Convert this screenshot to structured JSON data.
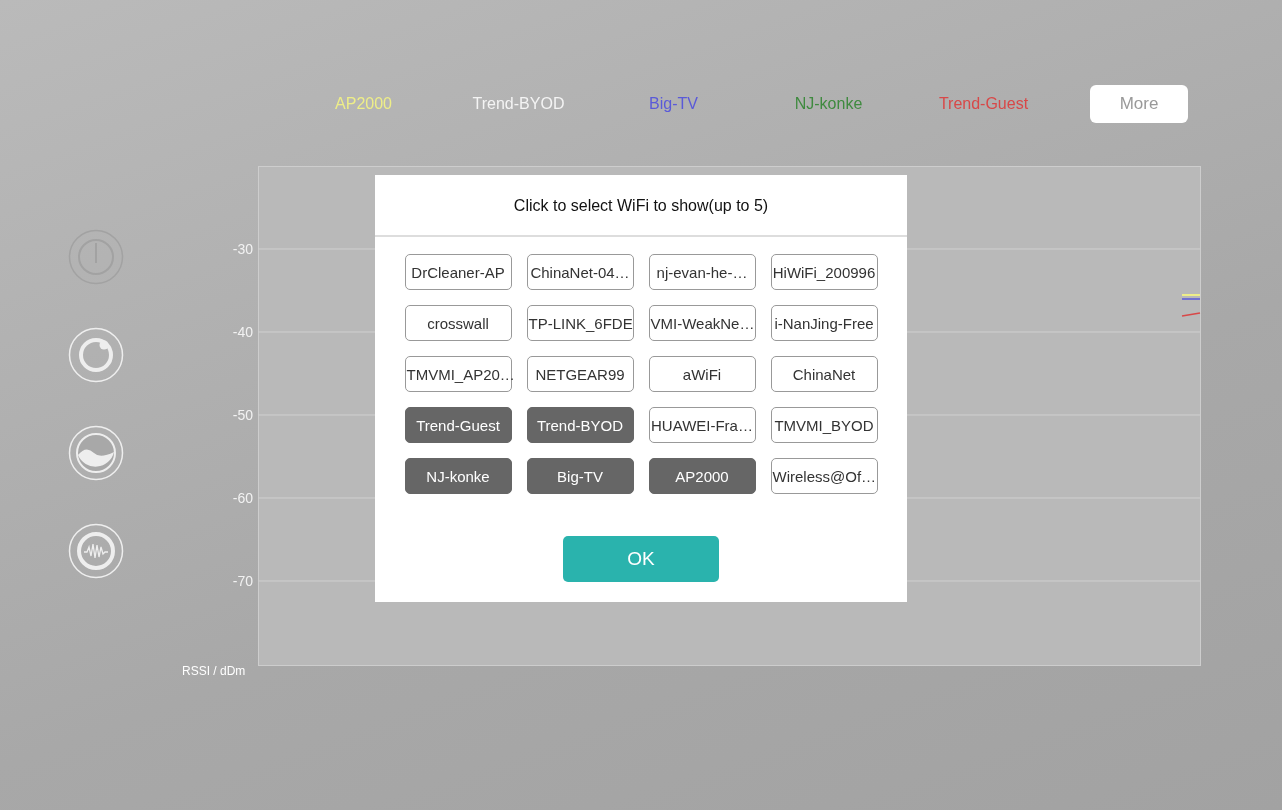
{
  "legend": [
    {
      "label": "AP2000",
      "color": "#eeee88"
    },
    {
      "label": "Trend-BYOD",
      "color": "#f4f4f4"
    },
    {
      "label": "Big-TV",
      "color": "#5a5ad8"
    },
    {
      "label": "NJ-konke",
      "color": "#3f8a3f"
    },
    {
      "label": "Trend-Guest",
      "color": "#d84848"
    }
  ],
  "more_button": "More",
  "side_buttons": [
    {
      "kind": "power",
      "disabled": true
    },
    {
      "kind": "ring",
      "disabled": false
    },
    {
      "kind": "wave",
      "disabled": false
    },
    {
      "kind": "pulse",
      "disabled": false
    }
  ],
  "chart": {
    "y_ticks": [
      "-30",
      "-40",
      "-50",
      "-60",
      "-70"
    ],
    "ylabel": "RSSI / dDm"
  },
  "dialog": {
    "title": "Click to select WiFi to show(up to 5)",
    "networks": [
      {
        "label": "DrCleaner-AP",
        "selected": false
      },
      {
        "label": "ChinaNet-04…",
        "selected": false
      },
      {
        "label": "nj-evan-he-…",
        "selected": false
      },
      {
        "label": "HiWiFi_200996",
        "selected": false
      },
      {
        "label": "crosswall",
        "selected": false
      },
      {
        "label": "TP-LINK_6FDE",
        "selected": false
      },
      {
        "label": "VMI-WeakNe…",
        "selected": false
      },
      {
        "label": "i-NanJing-Free",
        "selected": false
      },
      {
        "label": "TMVMI_AP20…",
        "selected": false
      },
      {
        "label": "NETGEAR99",
        "selected": false
      },
      {
        "label": "aWiFi",
        "selected": false
      },
      {
        "label": "ChinaNet",
        "selected": false
      },
      {
        "label": "Trend-Guest",
        "selected": true
      },
      {
        "label": "Trend-BYOD",
        "selected": true
      },
      {
        "label": "HUAWEI-Fra…",
        "selected": false
      },
      {
        "label": "TMVMI_BYOD",
        "selected": false
      },
      {
        "label": "NJ-konke",
        "selected": true
      },
      {
        "label": "Big-TV",
        "selected": true
      },
      {
        "label": "AP2000",
        "selected": true
      },
      {
        "label": "Wireless@Of…",
        "selected": false
      }
    ],
    "ok_button": "OK"
  }
}
